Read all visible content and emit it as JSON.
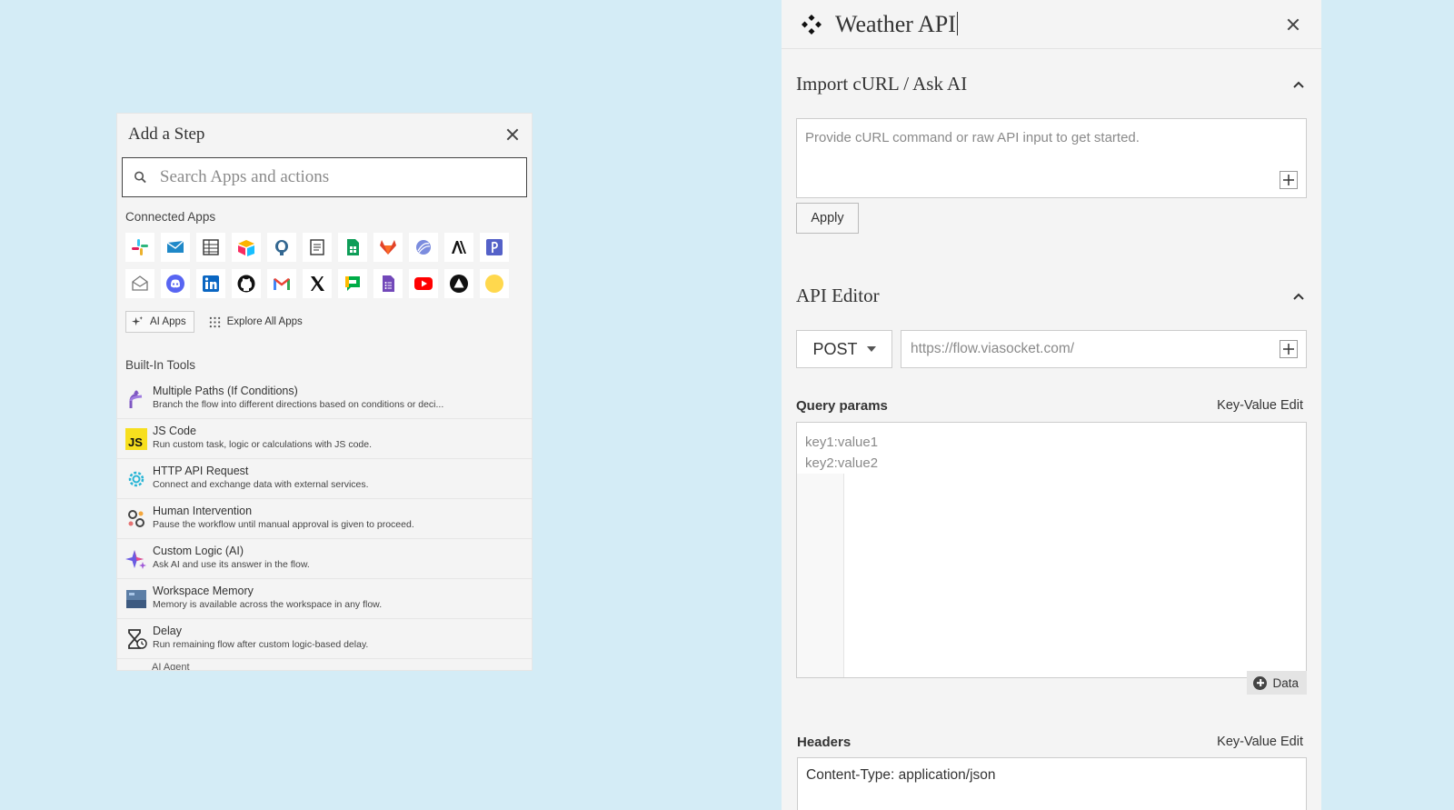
{
  "add_step": {
    "title": "Add a Step",
    "search_placeholder": "Search Apps and actions",
    "connected_label": "Connected Apps",
    "apps": [
      {
        "icon": "slack-icon"
      },
      {
        "icon": "mail-icon"
      },
      {
        "icon": "table-icon"
      },
      {
        "icon": "airtable-icon"
      },
      {
        "icon": "postgres-icon"
      },
      {
        "icon": "doc-icon"
      },
      {
        "icon": "google-sheets-icon"
      },
      {
        "icon": "gitlab-icon"
      },
      {
        "icon": "sphere-icon"
      },
      {
        "icon": "anthropic-icon"
      },
      {
        "icon": "pipedrive-icon"
      },
      {
        "icon": "envelope-open-icon"
      },
      {
        "icon": "discord-icon"
      },
      {
        "icon": "linkedin-icon"
      },
      {
        "icon": "github-icon"
      },
      {
        "icon": "gmail-icon"
      },
      {
        "icon": "x-icon"
      },
      {
        "icon": "google-chat-icon"
      },
      {
        "icon": "google-forms-icon"
      },
      {
        "icon": "youtube-icon"
      },
      {
        "icon": "triangle-icon"
      },
      {
        "icon": "yellow-circle-icon"
      }
    ],
    "ai_apps_label": "AI Apps",
    "explore_label": "Explore All Apps",
    "builtin_label": "Built-In Tools",
    "tools": [
      {
        "name": "Multiple Paths (If Conditions)",
        "desc": "Branch the flow into different directions based on conditions or deci..."
      },
      {
        "name": "JS Code",
        "desc": "Run custom task, logic or calculations with JS code."
      },
      {
        "name": "HTTP API Request",
        "desc": "Connect and exchange data with external services."
      },
      {
        "name": "Human Intervention",
        "desc": "Pause the workflow until manual approval is given to proceed."
      },
      {
        "name": "Custom Logic (AI)",
        "desc": "Ask AI and use its answer in the flow."
      },
      {
        "name": "Workspace Memory",
        "desc": "Memory is available across the workspace in any flow."
      },
      {
        "name": "Delay",
        "desc": "Run remaining flow after custom logic-based delay."
      }
    ],
    "tool_cut_text": "AI Agent"
  },
  "api": {
    "title": "Weather API",
    "import_title": "Import cURL / Ask AI",
    "curl_placeholder": "Provide cURL command or raw API input to get started.",
    "apply_label": "Apply",
    "editor_title": "API Editor",
    "method": "POST",
    "url_placeholder": "https://flow.viasocket.com/",
    "query_title": "Query params",
    "kv_edit_label": "Key-Value Edit",
    "query_ph_1": "key1:value1",
    "query_ph_2": "key2:value2",
    "data_label": "Data",
    "headers_title": "Headers",
    "headers_value": "Content-Type: application/json"
  }
}
